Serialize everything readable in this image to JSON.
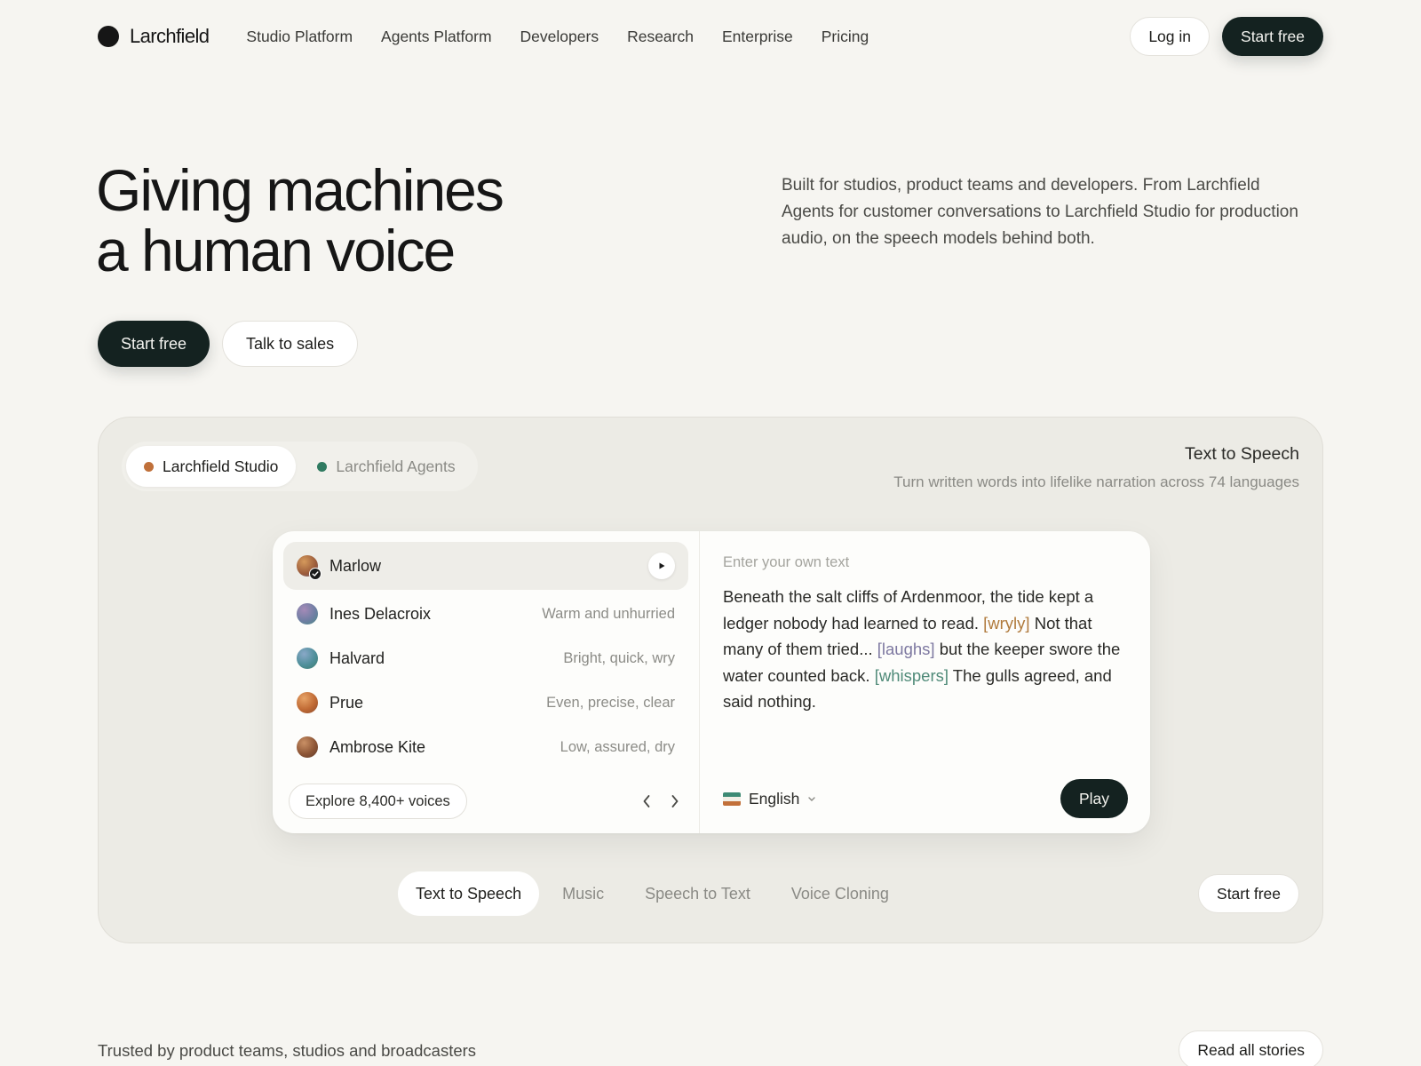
{
  "nav": {
    "brand": "Larchfield",
    "links": [
      "Studio Platform",
      "Agents Platform",
      "Developers",
      "Research",
      "Enterprise",
      "Pricing"
    ],
    "login": "Log in",
    "start": "Start free"
  },
  "hero": {
    "title_line1": "Giving machines",
    "title_line2": "a human voice",
    "description": "Built for studios, product teams and developers. From Larchfield Agents for customer conversations to Larchfield Studio for production audio, on the speech models behind both.",
    "cta_primary": "Start free",
    "cta_secondary": "Talk to sales"
  },
  "demo": {
    "toggle": [
      {
        "label": "Larchfield Studio",
        "color": "#c0703a",
        "active": true
      },
      {
        "label": "Larchfield Agents",
        "color": "#2f7a60",
        "active": false
      }
    ],
    "meta_title": "Text to Speech",
    "meta_subtitle": "Turn written words into lifelike narration across 74 languages",
    "voices": [
      {
        "name": "Marlow",
        "desc": "",
        "selected": true
      },
      {
        "name": "Ines Delacroix",
        "desc": "Warm and unhurried",
        "selected": false
      },
      {
        "name": "Halvard",
        "desc": "Bright, quick, wry",
        "selected": false
      },
      {
        "name": "Prue",
        "desc": "Even, precise, clear",
        "selected": false
      },
      {
        "name": "Ambrose Kite",
        "desc": "Low, assured, dry",
        "selected": false
      }
    ],
    "explore": "Explore 8,400+ voices",
    "editor_placeholder": "Enter your own text",
    "text_1": "Beneath the salt cliffs of Ardenmoor, the tide kept a ledger nobody had learned to read. ",
    "tag_1": "[wryly]",
    "text_2": " Not that many of them tried... ",
    "tag_2": "[laughs]",
    "text_3": " but the keeper swore the water counted back. ",
    "tag_3": "[whispers]",
    "text_4": " The gulls agreed, and said nothing.",
    "language": "English",
    "play": "Play",
    "modes": [
      "Text to Speech",
      "Music",
      "Speech to Text",
      "Voice Cloning"
    ],
    "active_mode": 0,
    "start": "Start free"
  },
  "footer": {
    "trusted": "Trusted by product teams, studios and broadcasters",
    "read_stories": "Read all stories"
  }
}
